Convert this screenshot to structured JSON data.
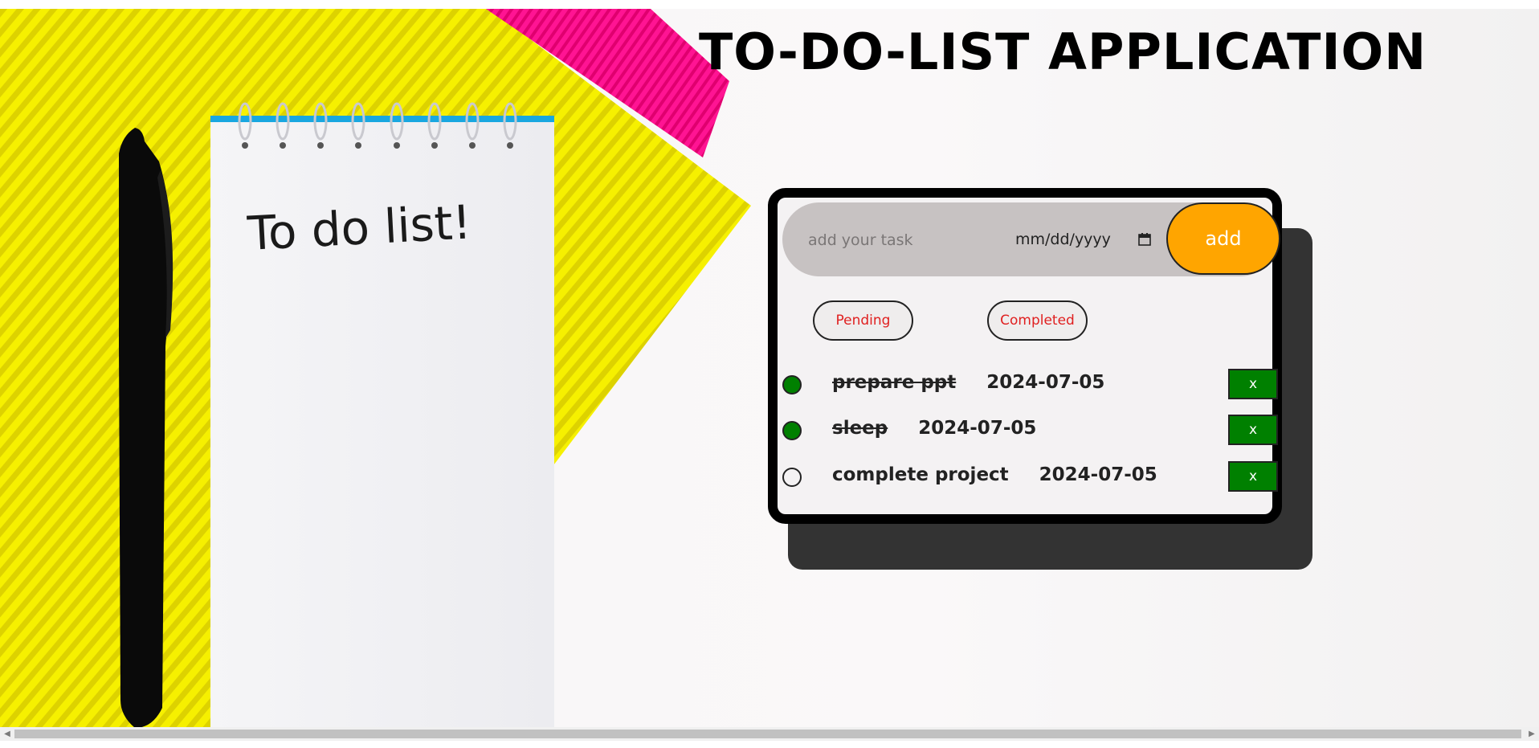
{
  "page": {
    "title": "TO-DO-LIST APPLICATION"
  },
  "form": {
    "task_placeholder": "add your task",
    "task_value": "",
    "date_placeholder": "mm/dd/yyyy",
    "add_label": "add"
  },
  "filters": {
    "pending_label": "Pending",
    "completed_label": "Completed"
  },
  "tasks": [
    {
      "name": "prepare ppt",
      "date": "2024-07-05",
      "completed": true,
      "delete_label": "x"
    },
    {
      "name": "sleep",
      "date": "2024-07-05",
      "completed": true,
      "delete_label": "x"
    },
    {
      "name": "complete project",
      "date": "2024-07-05",
      "completed": false,
      "delete_label": "x"
    }
  ],
  "illustration": {
    "notepad_text": "To do list!"
  },
  "colors": {
    "accent_add": "#ffa500",
    "done_green": "#008000",
    "filter_text": "#e02020",
    "card_border": "#000000",
    "input_bar": "#c7c2c2",
    "shadow": "#333333"
  },
  "icons": [
    "calendar-icon",
    "scroll-left-icon",
    "scroll-right-icon"
  ]
}
